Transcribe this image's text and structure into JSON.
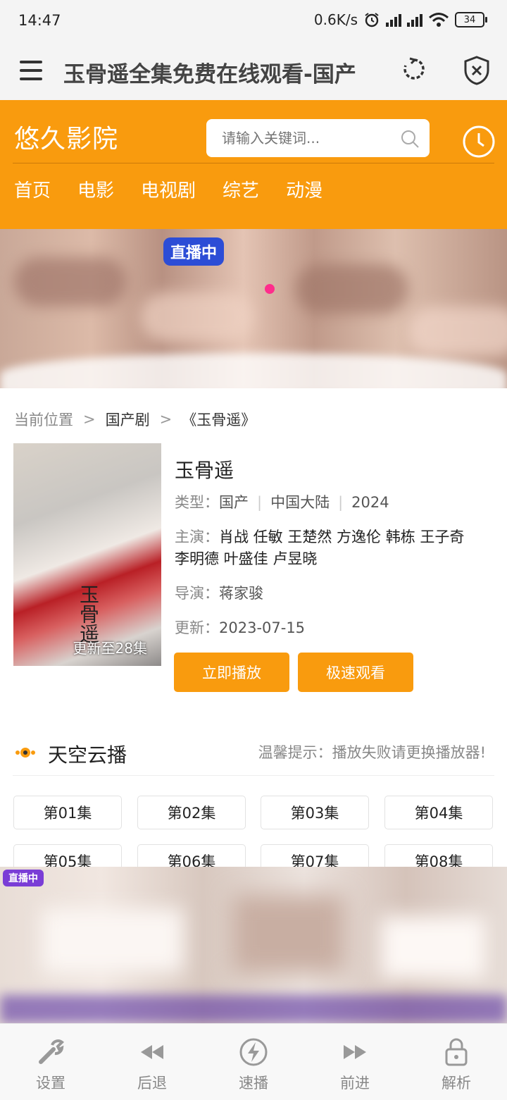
{
  "status_bar": {
    "time": "14:47",
    "speed": "0.6K/s",
    "battery": "34",
    "icons": [
      "alarm-icon",
      "hd-signal-icon",
      "hd-signal-icon",
      "wifi-icon",
      "battery-icon"
    ]
  },
  "browser": {
    "title": "玉骨遥全集免费在线观看-国产",
    "icons": [
      "menu-icon",
      "reload-icon",
      "shield-close-icon"
    ]
  },
  "site": {
    "logo": "悠久影院",
    "search_placeholder": "请输入关键词...",
    "nav": [
      "首页",
      "电影",
      "电视剧",
      "综艺",
      "动漫"
    ],
    "accent_color": "#f99b0e"
  },
  "banner_top": {
    "badge": "直播中"
  },
  "breadcrumb": {
    "label": "当前位置",
    "category": "国产剧",
    "current": "《玉骨遥》"
  },
  "detail": {
    "title": "玉骨遥",
    "poster_update": "更新至28集",
    "poster_calligraphy": "玉骨遥",
    "type_label": "类型：",
    "type": "国产",
    "region": "中国大陆",
    "year": "2024",
    "cast_label": "主演：",
    "cast": "肖战 任敏 王楚然 方逸伦 韩栋 王子奇 李明德 叶盛佳 卢昱晓",
    "director_label": "导演：",
    "director": "蒋家骏",
    "updated_label": "更新：",
    "updated": "2023-07-15",
    "play_button": "立即播放",
    "fast_button": "极速观看"
  },
  "source": {
    "name": "天空云播",
    "hint": "温馨提示：播放失败请更换播放器!",
    "episodes": [
      "第01集",
      "第02集",
      "第03集",
      "第04集",
      "第05集",
      "第06集",
      "第07集",
      "第08集"
    ]
  },
  "banner_bottom": {
    "badge": "直播中"
  },
  "toolbar": {
    "items": [
      {
        "label": "设置",
        "icon": "wrench-icon"
      },
      {
        "label": "后退",
        "icon": "back-icon"
      },
      {
        "label": "速播",
        "icon": "lightning-icon"
      },
      {
        "label": "前进",
        "icon": "forward-icon"
      },
      {
        "label": "解析",
        "icon": "lock-icon"
      }
    ]
  }
}
